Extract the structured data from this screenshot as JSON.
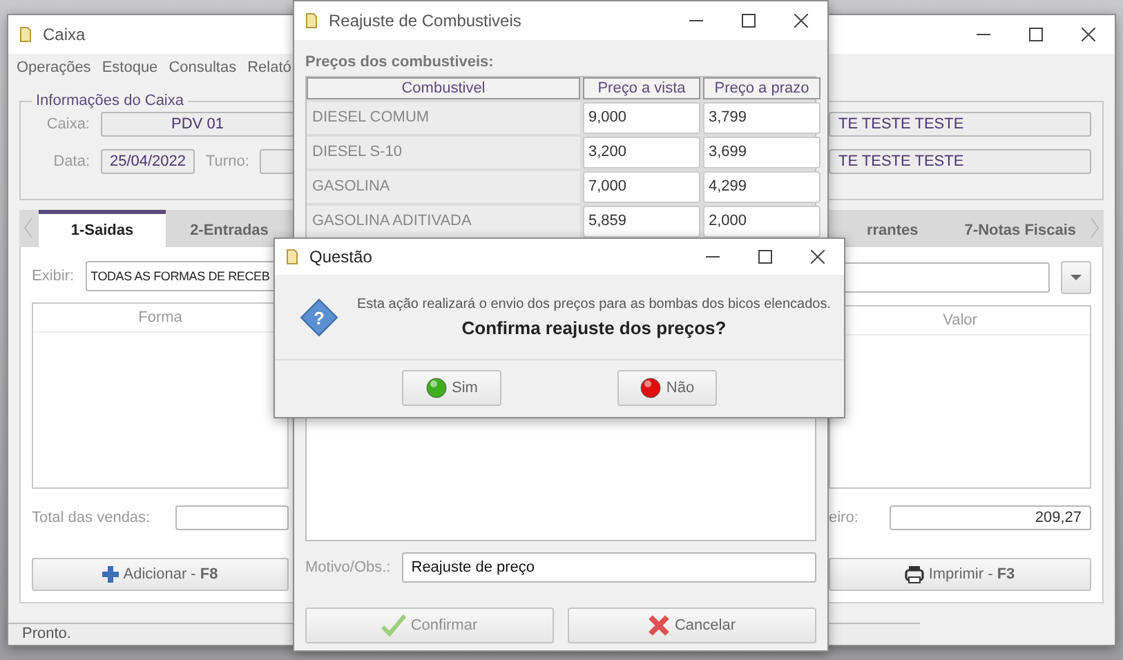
{
  "main_window": {
    "title": "Caixa",
    "menu": [
      "Operações",
      "Estoque",
      "Consultas",
      "Relató"
    ],
    "group_title": "Informações do Caixa",
    "caixa_label": "Caixa:",
    "caixa_value": "PDV 01",
    "data_label": "Data:",
    "data_value": "25/04/2022",
    "turno_label": "Turno:",
    "right_fields": [
      "TE TESTE TESTE",
      "TE TESTE TESTE"
    ],
    "tabs": [
      {
        "label": "1-Saidas",
        "selected": true
      },
      {
        "label": "2-Entradas",
        "selected": false
      },
      {
        "label": "rrantes",
        "selected": false
      },
      {
        "label": "7-Notas Fiscais",
        "selected": false
      }
    ],
    "exibir_label": "Exibir:",
    "exibir_value": "TODAS AS FORMAS DE RECEB",
    "columns": [
      "Forma",
      "Valor"
    ],
    "total_label": "Total das vendas:",
    "right_total_label": "eiro:",
    "right_total_value": "209,27",
    "buttons": [
      {
        "kind": "add",
        "label": "Adicionar - **F8**"
      },
      {
        "kind": "print",
        "label": "Imprimir - **F3**"
      }
    ],
    "status": "Pronto."
  },
  "adjust_window": {
    "title": "Reajuste de Combustiveis",
    "section": "Preços dos combustiveis:",
    "columns": [
      "Combustivel",
      "Preço a vista",
      "Preço a prazo"
    ],
    "rows": [
      {
        "name": "DIESEL COMUM",
        "cash": "9,000",
        "term": "3,799"
      },
      {
        "name": "DIESEL S-10",
        "cash": "3,200",
        "term": "3,699"
      },
      {
        "name": "GASOLINA",
        "cash": "7,000",
        "term": "4,299"
      },
      {
        "name": "GASOLINA ADITIVADA",
        "cash": "5,859",
        "term": "2,000"
      }
    ],
    "motivo_label": "Motivo/Obs.:",
    "motivo_value": "Reajuste de preço",
    "buttons": [
      {
        "kind": "confirm",
        "label": "Confirmar",
        "disabled": true
      },
      {
        "kind": "cancel",
        "label": "Cancelar",
        "disabled": false
      }
    ]
  },
  "question_dialog": {
    "title": "Questão",
    "icon_text": "?",
    "message": "Esta ação realizará o envio dos preços para as bombas dos bicos elencados.",
    "question": "Confirma reajuste dos preços?",
    "buttons": [
      {
        "kind": "yes",
        "label": "Sim"
      },
      {
        "kind": "no",
        "label": "Não"
      }
    ]
  }
}
